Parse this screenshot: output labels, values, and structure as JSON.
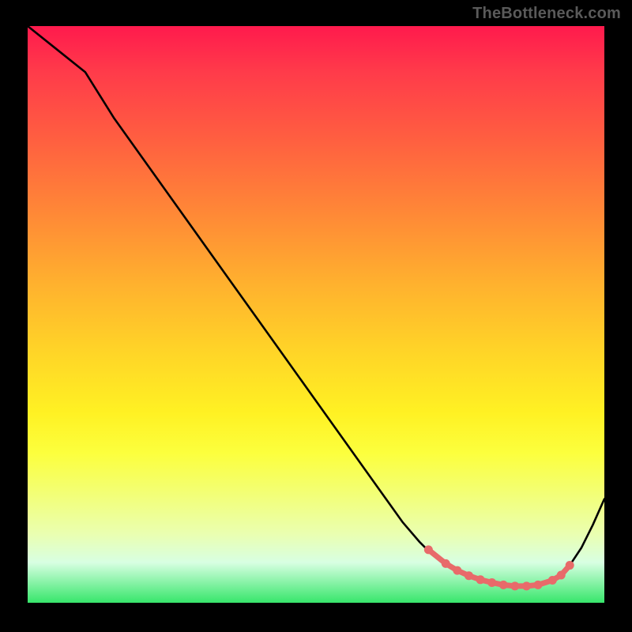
{
  "watermark": "TheBottleneck.com",
  "chart_data": {
    "type": "line",
    "title": "",
    "xlabel": "",
    "ylabel": "",
    "xlim": [
      0,
      100
    ],
    "ylim": [
      0,
      100
    ],
    "grid": false,
    "legend": false,
    "series": [
      {
        "name": "curve",
        "color": "#000000",
        "x": [
          0,
          5,
          10,
          15,
          20,
          25,
          30,
          35,
          40,
          45,
          50,
          55,
          60,
          65,
          68,
          70,
          72,
          74,
          76,
          78,
          80,
          82,
          84,
          86,
          88,
          90,
          92,
          94,
          96,
          98,
          100
        ],
        "y": [
          100,
          96,
          92,
          84,
          77,
          70,
          63,
          56,
          49,
          42,
          35,
          28,
          21,
          14,
          10.5,
          8.5,
          7,
          5.8,
          4.8,
          4,
          3.4,
          3,
          2.8,
          2.8,
          2.9,
          3.3,
          4.4,
          6.5,
          9.5,
          13.5,
          18
        ]
      },
      {
        "name": "dots",
        "color": "#e86a6a",
        "style": "markers",
        "x": [
          69.5,
          72.5,
          74.5,
          76.5,
          78.5,
          80.5,
          82.5,
          84.5,
          86.5,
          88.5,
          91.0,
          92.5,
          94.0
        ],
        "y": [
          9.2,
          6.8,
          5.6,
          4.7,
          4.0,
          3.5,
          3.1,
          2.9,
          2.9,
          3.1,
          3.9,
          4.8,
          6.5
        ]
      }
    ],
    "background": "rainbow-vertical-gradient"
  }
}
